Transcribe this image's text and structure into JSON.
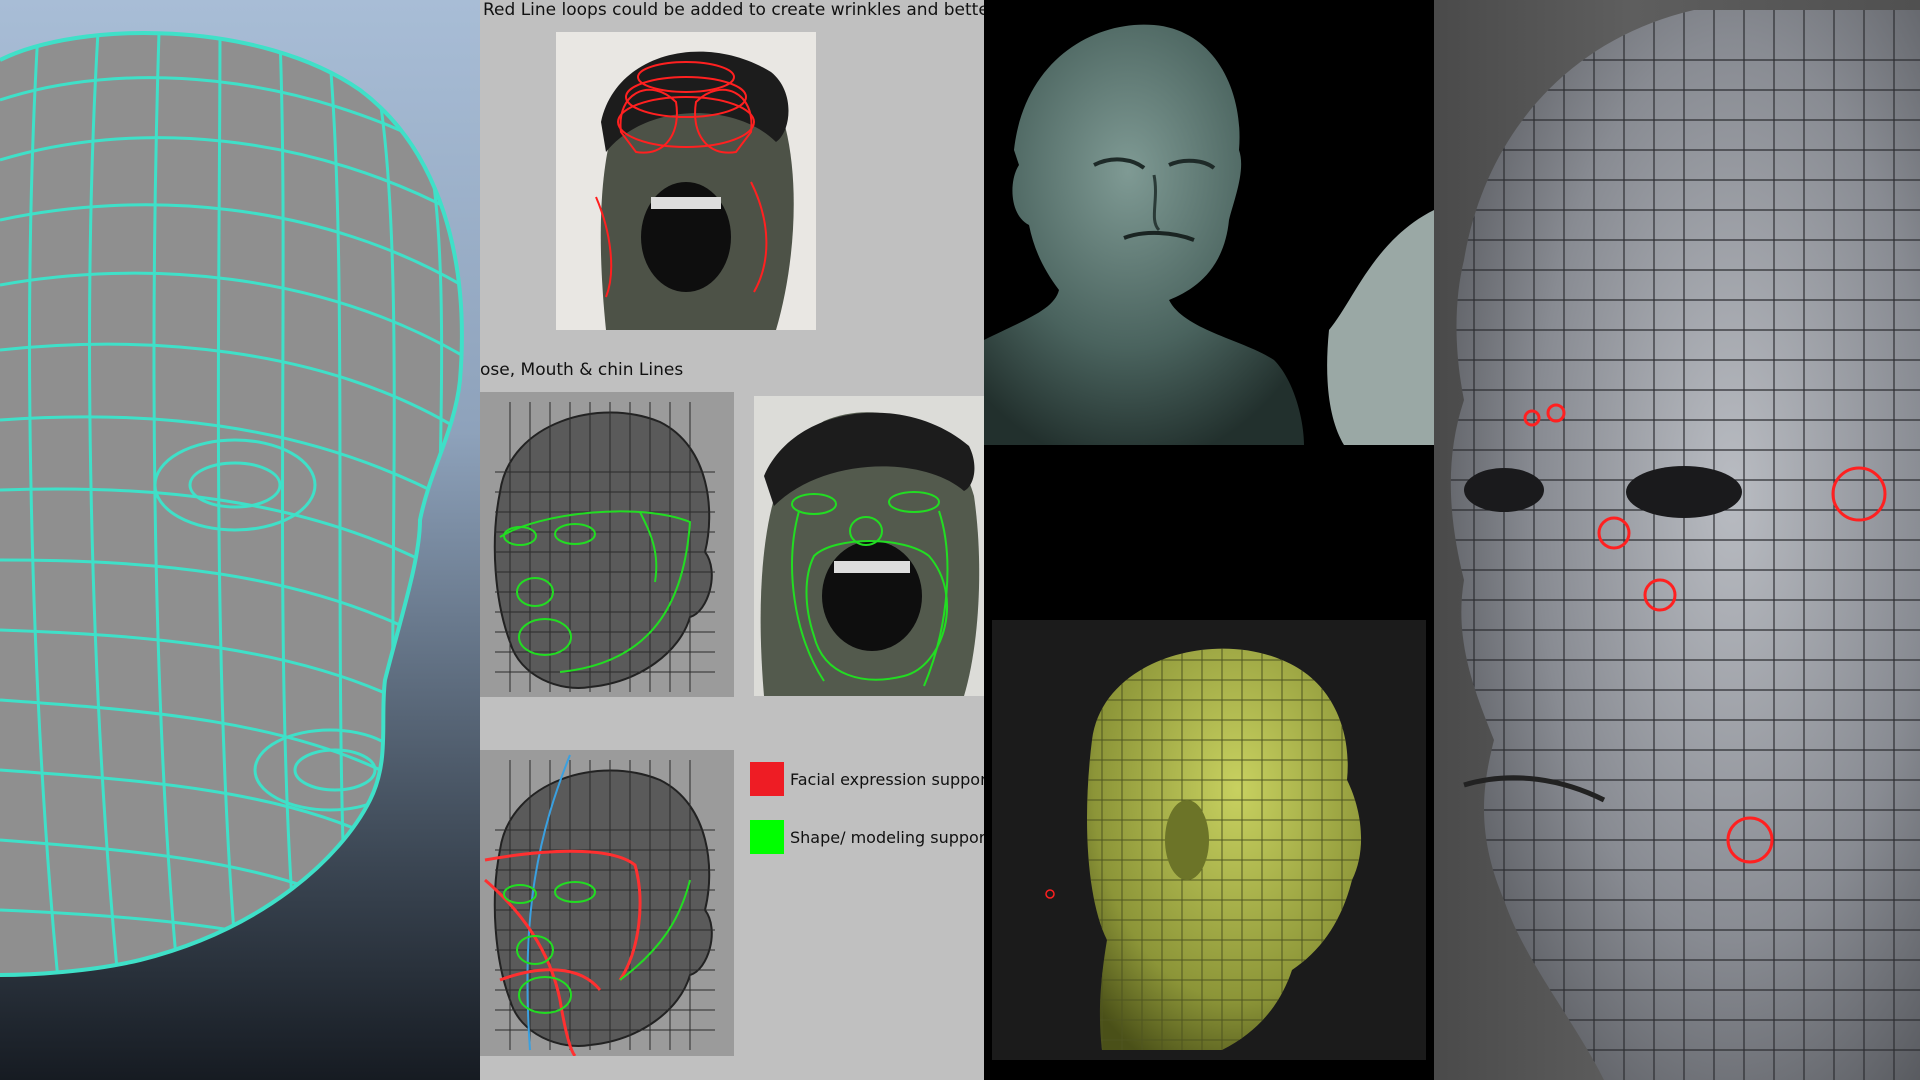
{
  "captions": {
    "red_loops": "Red Line loops could be added to create wrinkles and better expres",
    "nose_mouth": "ose, Mouth & chin Lines"
  },
  "legend": [
    {
      "label": "Facial expression support li",
      "color": "#ee1c24"
    },
    {
      "label": "Shape/ modeling support li",
      "color": "#00ff00"
    }
  ],
  "colors": {
    "wire_cyan": "#3fe0c8",
    "red_loop": "#ff2020",
    "green_loop": "#22dd22",
    "sculpt_teal": "#4d6762",
    "sculpt_green": "#a9b54a"
  }
}
